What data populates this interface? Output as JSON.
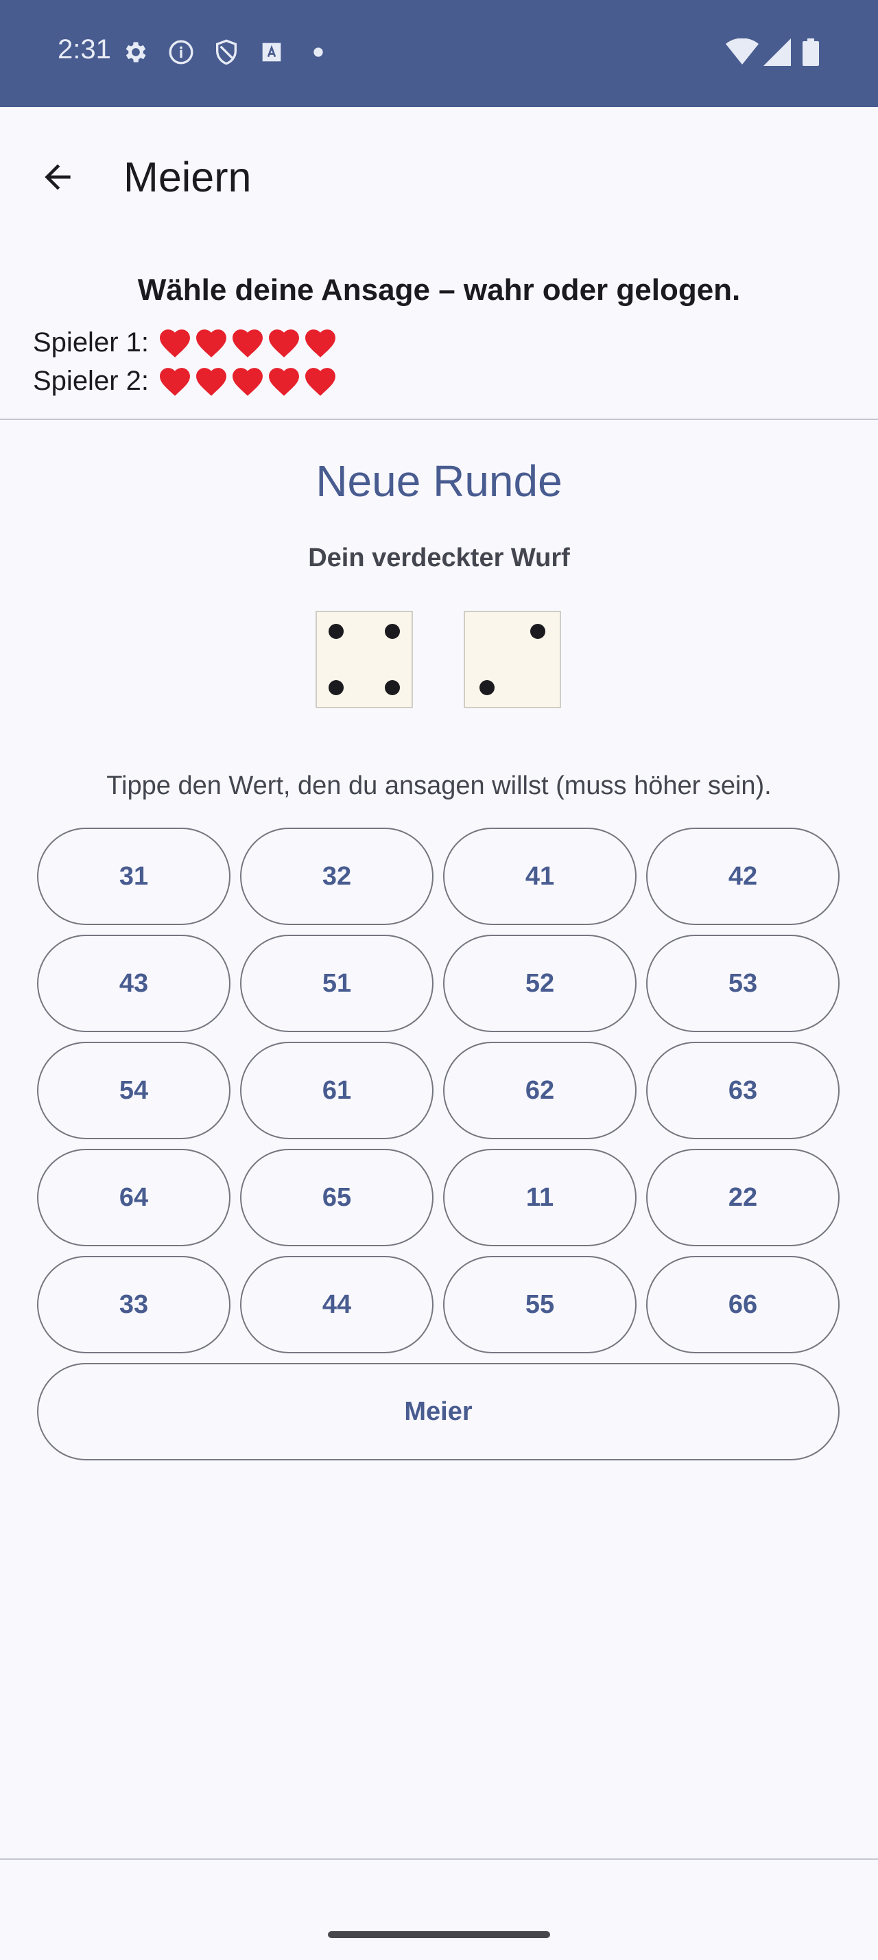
{
  "status_bar": {
    "time": "2:31",
    "icons": [
      "gear-icon",
      "info-icon",
      "shield-icon",
      "font-icon",
      "dot-icon"
    ],
    "right_icons": [
      "wifi-icon",
      "signal-icon",
      "battery-icon"
    ]
  },
  "app_bar": {
    "title": "Meiern",
    "back_icon": "arrow-back-icon"
  },
  "prompt": "Wähle deine Ansage – wahr oder gelogen.",
  "players": [
    {
      "label": "Spieler 1:",
      "lives": 5
    },
    {
      "label": "Spieler 2:",
      "lives": 5
    }
  ],
  "round_title": "Neue Runde",
  "hidden_roll_label": "Dein verdeckter Wurf",
  "dice": [
    4,
    2
  ],
  "hint": "Tippe den Wert, den du ansagen willst (muss höher sein).",
  "bids": [
    "31",
    "32",
    "41",
    "42",
    "43",
    "51",
    "52",
    "53",
    "54",
    "61",
    "62",
    "63",
    "64",
    "65",
    "11",
    "22",
    "33",
    "44",
    "55",
    "66"
  ],
  "meier_label": "Meier",
  "colors": {
    "primary": "#485c90",
    "background": "#f9f8fd",
    "heart": "#e6212b",
    "die_face": "#faf6eb"
  }
}
